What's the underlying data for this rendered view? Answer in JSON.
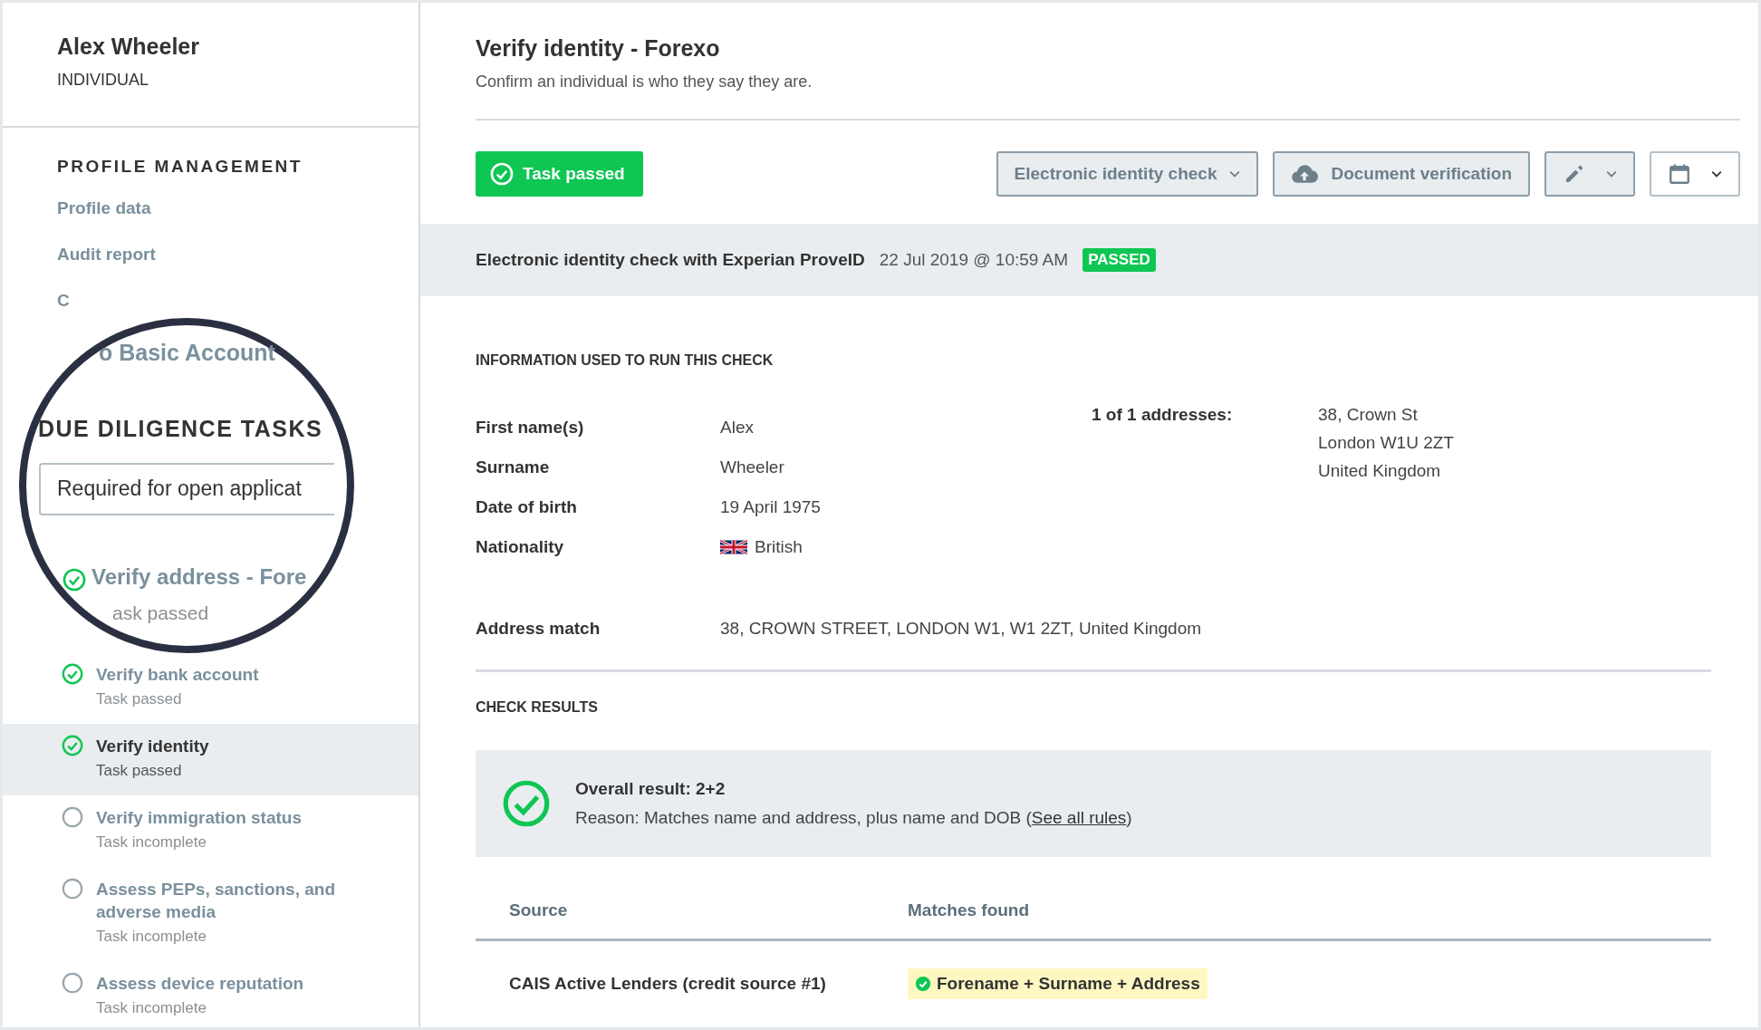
{
  "sidebar": {
    "profile": {
      "name": "Alex Wheeler",
      "type": "INDIVIDUAL"
    },
    "section_title": "PROFILE MANAGEMENT",
    "links": [
      "Profile data",
      "Audit report",
      "C"
    ],
    "magnifier": {
      "link": "o Basic Account",
      "section_title": "DUE DILIGENCE TASKS",
      "filter": {
        "value": "Required for open applicat"
      },
      "task": {
        "title": "Verify address - Fore",
        "status": "ask passed",
        "passed": true
      }
    },
    "tasks": [
      {
        "title": "Verify bank account",
        "status": "Task passed",
        "passed": true,
        "selected": false
      },
      {
        "title": "Verify identity",
        "status": "Task passed",
        "passed": true,
        "selected": true
      },
      {
        "title": "Verify immigration status",
        "status": "Task incomplete",
        "passed": false,
        "selected": false
      },
      {
        "title": "Assess PEPs, sanctions, and adverse media",
        "status": "Task incomplete",
        "passed": false,
        "selected": false
      },
      {
        "title": "Assess device reputation",
        "status": "Task incomplete",
        "passed": false,
        "selected": false
      }
    ]
  },
  "header": {
    "title": "Verify identity - Forexo",
    "subtitle": "Confirm an individual is who they say they are."
  },
  "toolbar": {
    "status_button": "Task passed",
    "check_dropdown": "Electronic identity check",
    "upload_button": "Document verification"
  },
  "check_banner": {
    "title": "Electronic identity check with Experian ProveID",
    "timestamp": "22 Jul 2019 @ 10:59 AM",
    "badge": "PASSED"
  },
  "information": {
    "heading": "INFORMATION USED TO RUN THIS CHECK",
    "fields": [
      {
        "label": "First name(s)",
        "value": "Alex"
      },
      {
        "label": "Surname",
        "value": "Wheeler"
      },
      {
        "label": "Date of birth",
        "value": "19 April 1975"
      },
      {
        "label": "Nationality",
        "value": "British",
        "kind": "flag"
      }
    ],
    "address": {
      "label": "1 of 1 addresses:",
      "lines": [
        "38, Crown St",
        "London W1U 2ZT",
        "United Kingdom"
      ]
    },
    "address_match": {
      "label": "Address match",
      "value": "38, CROWN STREET, LONDON W1, W1 2ZT, United Kingdom"
    }
  },
  "results": {
    "heading": "CHECK RESULTS",
    "overall": "Overall result: 2+2",
    "reason": "Reason: Matches name and address, plus name and DOB (",
    "rules_link": "See all rules",
    "reason_end": ")",
    "table": {
      "columns": [
        "Source",
        "Matches found"
      ],
      "rows": [
        {
          "source": "CAIS Active Lenders (credit source #1)",
          "match": "Forename + Surname + Address"
        }
      ]
    }
  }
}
